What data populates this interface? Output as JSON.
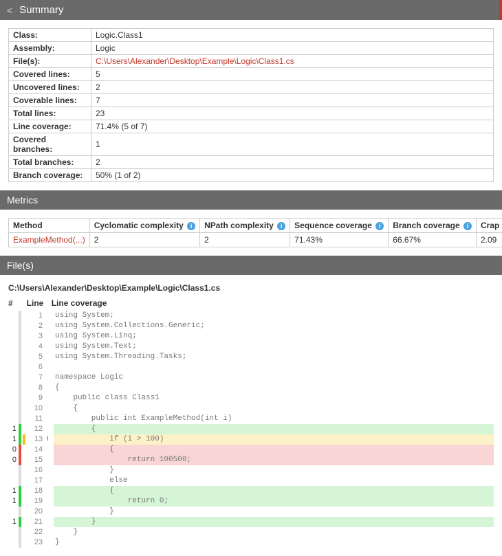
{
  "header": {
    "back": "<",
    "title": "Summary"
  },
  "summary": {
    "rows": [
      {
        "label": "Class:",
        "value": "Logic.Class1"
      },
      {
        "label": "Assembly:",
        "value": "Logic"
      },
      {
        "label": "File(s):",
        "value": "C:\\Users\\Alexander\\Desktop\\Example\\Logic\\Class1.cs",
        "link": true
      },
      {
        "label": "Covered lines:",
        "value": "5"
      },
      {
        "label": "Uncovered lines:",
        "value": "2"
      },
      {
        "label": "Coverable lines:",
        "value": "7"
      },
      {
        "label": "Total lines:",
        "value": "23"
      },
      {
        "label": "Line coverage:",
        "value": "71.4% (5 of 7)"
      },
      {
        "label": "Covered branches:",
        "value": "1"
      },
      {
        "label": "Total branches:",
        "value": "2"
      },
      {
        "label": "Branch coverage:",
        "value": "50% (1 of 2)"
      }
    ]
  },
  "sections": {
    "metrics": "Metrics",
    "files": "File(s)"
  },
  "metrics": {
    "headers": {
      "method": "Method",
      "cc": "Cyclomatic complexity",
      "npath": "NPath complexity",
      "seq": "Sequence coverage",
      "branch": "Branch coverage",
      "crap": "Crap Score"
    },
    "row": {
      "method": "ExampleMethod(...)",
      "cc": "2",
      "npath": "2",
      "seq": "71.43%",
      "branch": "66.67%",
      "crap": "2.09"
    }
  },
  "file": {
    "path": "C:\\Users\\Alexander\\Desktop\\Example\\Logic\\Class1.cs",
    "head": {
      "hash": "#",
      "line": "Line",
      "cov": "Line coverage"
    },
    "lines": [
      {
        "n": 1,
        "hits": "",
        "bar": "gray",
        "branch": "",
        "glyph": "",
        "code": "using System;",
        "row": ""
      },
      {
        "n": 2,
        "hits": "",
        "bar": "gray",
        "branch": "",
        "glyph": "",
        "code": "using System.Collections.Generic;",
        "row": ""
      },
      {
        "n": 3,
        "hits": "",
        "bar": "gray",
        "branch": "",
        "glyph": "",
        "code": "using System.Linq;",
        "row": ""
      },
      {
        "n": 4,
        "hits": "",
        "bar": "gray",
        "branch": "",
        "glyph": "",
        "code": "using System.Text;",
        "row": ""
      },
      {
        "n": 5,
        "hits": "",
        "bar": "gray",
        "branch": "",
        "glyph": "",
        "code": "using System.Threading.Tasks;",
        "row": ""
      },
      {
        "n": 6,
        "hits": "",
        "bar": "gray",
        "branch": "",
        "glyph": "",
        "code": "",
        "row": ""
      },
      {
        "n": 7,
        "hits": "",
        "bar": "gray",
        "branch": "",
        "glyph": "",
        "code": "namespace Logic",
        "row": ""
      },
      {
        "n": 8,
        "hits": "",
        "bar": "gray",
        "branch": "",
        "glyph": "",
        "code": "{",
        "row": ""
      },
      {
        "n": 9,
        "hits": "",
        "bar": "gray",
        "branch": "",
        "glyph": "",
        "code": "    public class Class1",
        "row": ""
      },
      {
        "n": 10,
        "hits": "",
        "bar": "gray",
        "branch": "",
        "glyph": "",
        "code": "    {",
        "row": ""
      },
      {
        "n": 11,
        "hits": "",
        "bar": "gray",
        "branch": "",
        "glyph": "",
        "code": "        public int ExampleMethod(int i)",
        "row": ""
      },
      {
        "n": 12,
        "hits": "1",
        "bar": "green",
        "branch": "",
        "glyph": "",
        "code": "        {",
        "row": "green"
      },
      {
        "n": 13,
        "hits": "1",
        "bar": "green",
        "branch": "yellow",
        "glyph": "⍿",
        "code": "            if (i > 100)",
        "row": "yellow"
      },
      {
        "n": 14,
        "hits": "0",
        "bar": "red",
        "branch": "",
        "glyph": "",
        "code": "            {",
        "row": "red"
      },
      {
        "n": 15,
        "hits": "0",
        "bar": "red",
        "branch": "",
        "glyph": "",
        "code": "                return 100500;",
        "row": "red"
      },
      {
        "n": 16,
        "hits": "",
        "bar": "gray",
        "branch": "",
        "glyph": "",
        "code": "            }",
        "row": ""
      },
      {
        "n": 17,
        "hits": "",
        "bar": "gray",
        "branch": "",
        "glyph": "",
        "code": "            else",
        "row": ""
      },
      {
        "n": 18,
        "hits": "1",
        "bar": "green",
        "branch": "",
        "glyph": "",
        "code": "            {",
        "row": "green"
      },
      {
        "n": 19,
        "hits": "1",
        "bar": "green",
        "branch": "",
        "glyph": "",
        "code": "                return 0;",
        "row": "green"
      },
      {
        "n": 20,
        "hits": "",
        "bar": "gray",
        "branch": "",
        "glyph": "",
        "code": "            }",
        "row": ""
      },
      {
        "n": 21,
        "hits": "1",
        "bar": "green",
        "branch": "",
        "glyph": "",
        "code": "        }",
        "row": "green"
      },
      {
        "n": 22,
        "hits": "",
        "bar": "gray",
        "branch": "",
        "glyph": "",
        "code": "    }",
        "row": ""
      },
      {
        "n": 23,
        "hits": "",
        "bar": "gray",
        "branch": "",
        "glyph": "",
        "code": "}",
        "row": ""
      }
    ]
  }
}
